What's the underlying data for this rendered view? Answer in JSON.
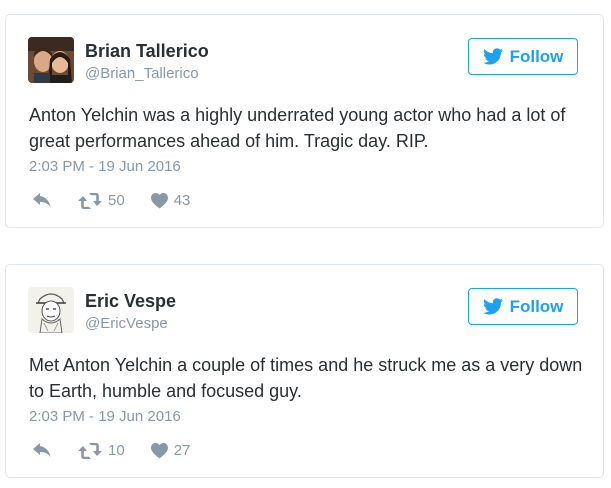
{
  "tweets": [
    {
      "name": "Brian Tallerico",
      "handle": "@Brian_Tallerico",
      "follow_label": "Follow",
      "text": "Anton Yelchin was a highly underrated young actor who had a lot of great performances ahead of him. Tragic day. RIP.",
      "timestamp": "2:03 PM - 19 Jun 2016",
      "retweets": "50",
      "likes": "43"
    },
    {
      "name": "Eric Vespe",
      "handle": "@EricVespe",
      "follow_label": "Follow",
      "text": "Met Anton Yelchin a couple of times and he struck me as a very down to Earth, humble and focused guy.",
      "timestamp": "2:03 PM - 19 Jun 2016",
      "retweets": "10",
      "likes": "27"
    }
  ],
  "icons": {
    "brand": "twitter-bird-icon",
    "reply": "reply-icon",
    "retweet": "retweet-icon",
    "like": "heart-icon"
  },
  "colors": {
    "accent": "#1da1f2",
    "muted": "#8899a6",
    "text": "#292f33",
    "border": "#e1e8ed"
  }
}
